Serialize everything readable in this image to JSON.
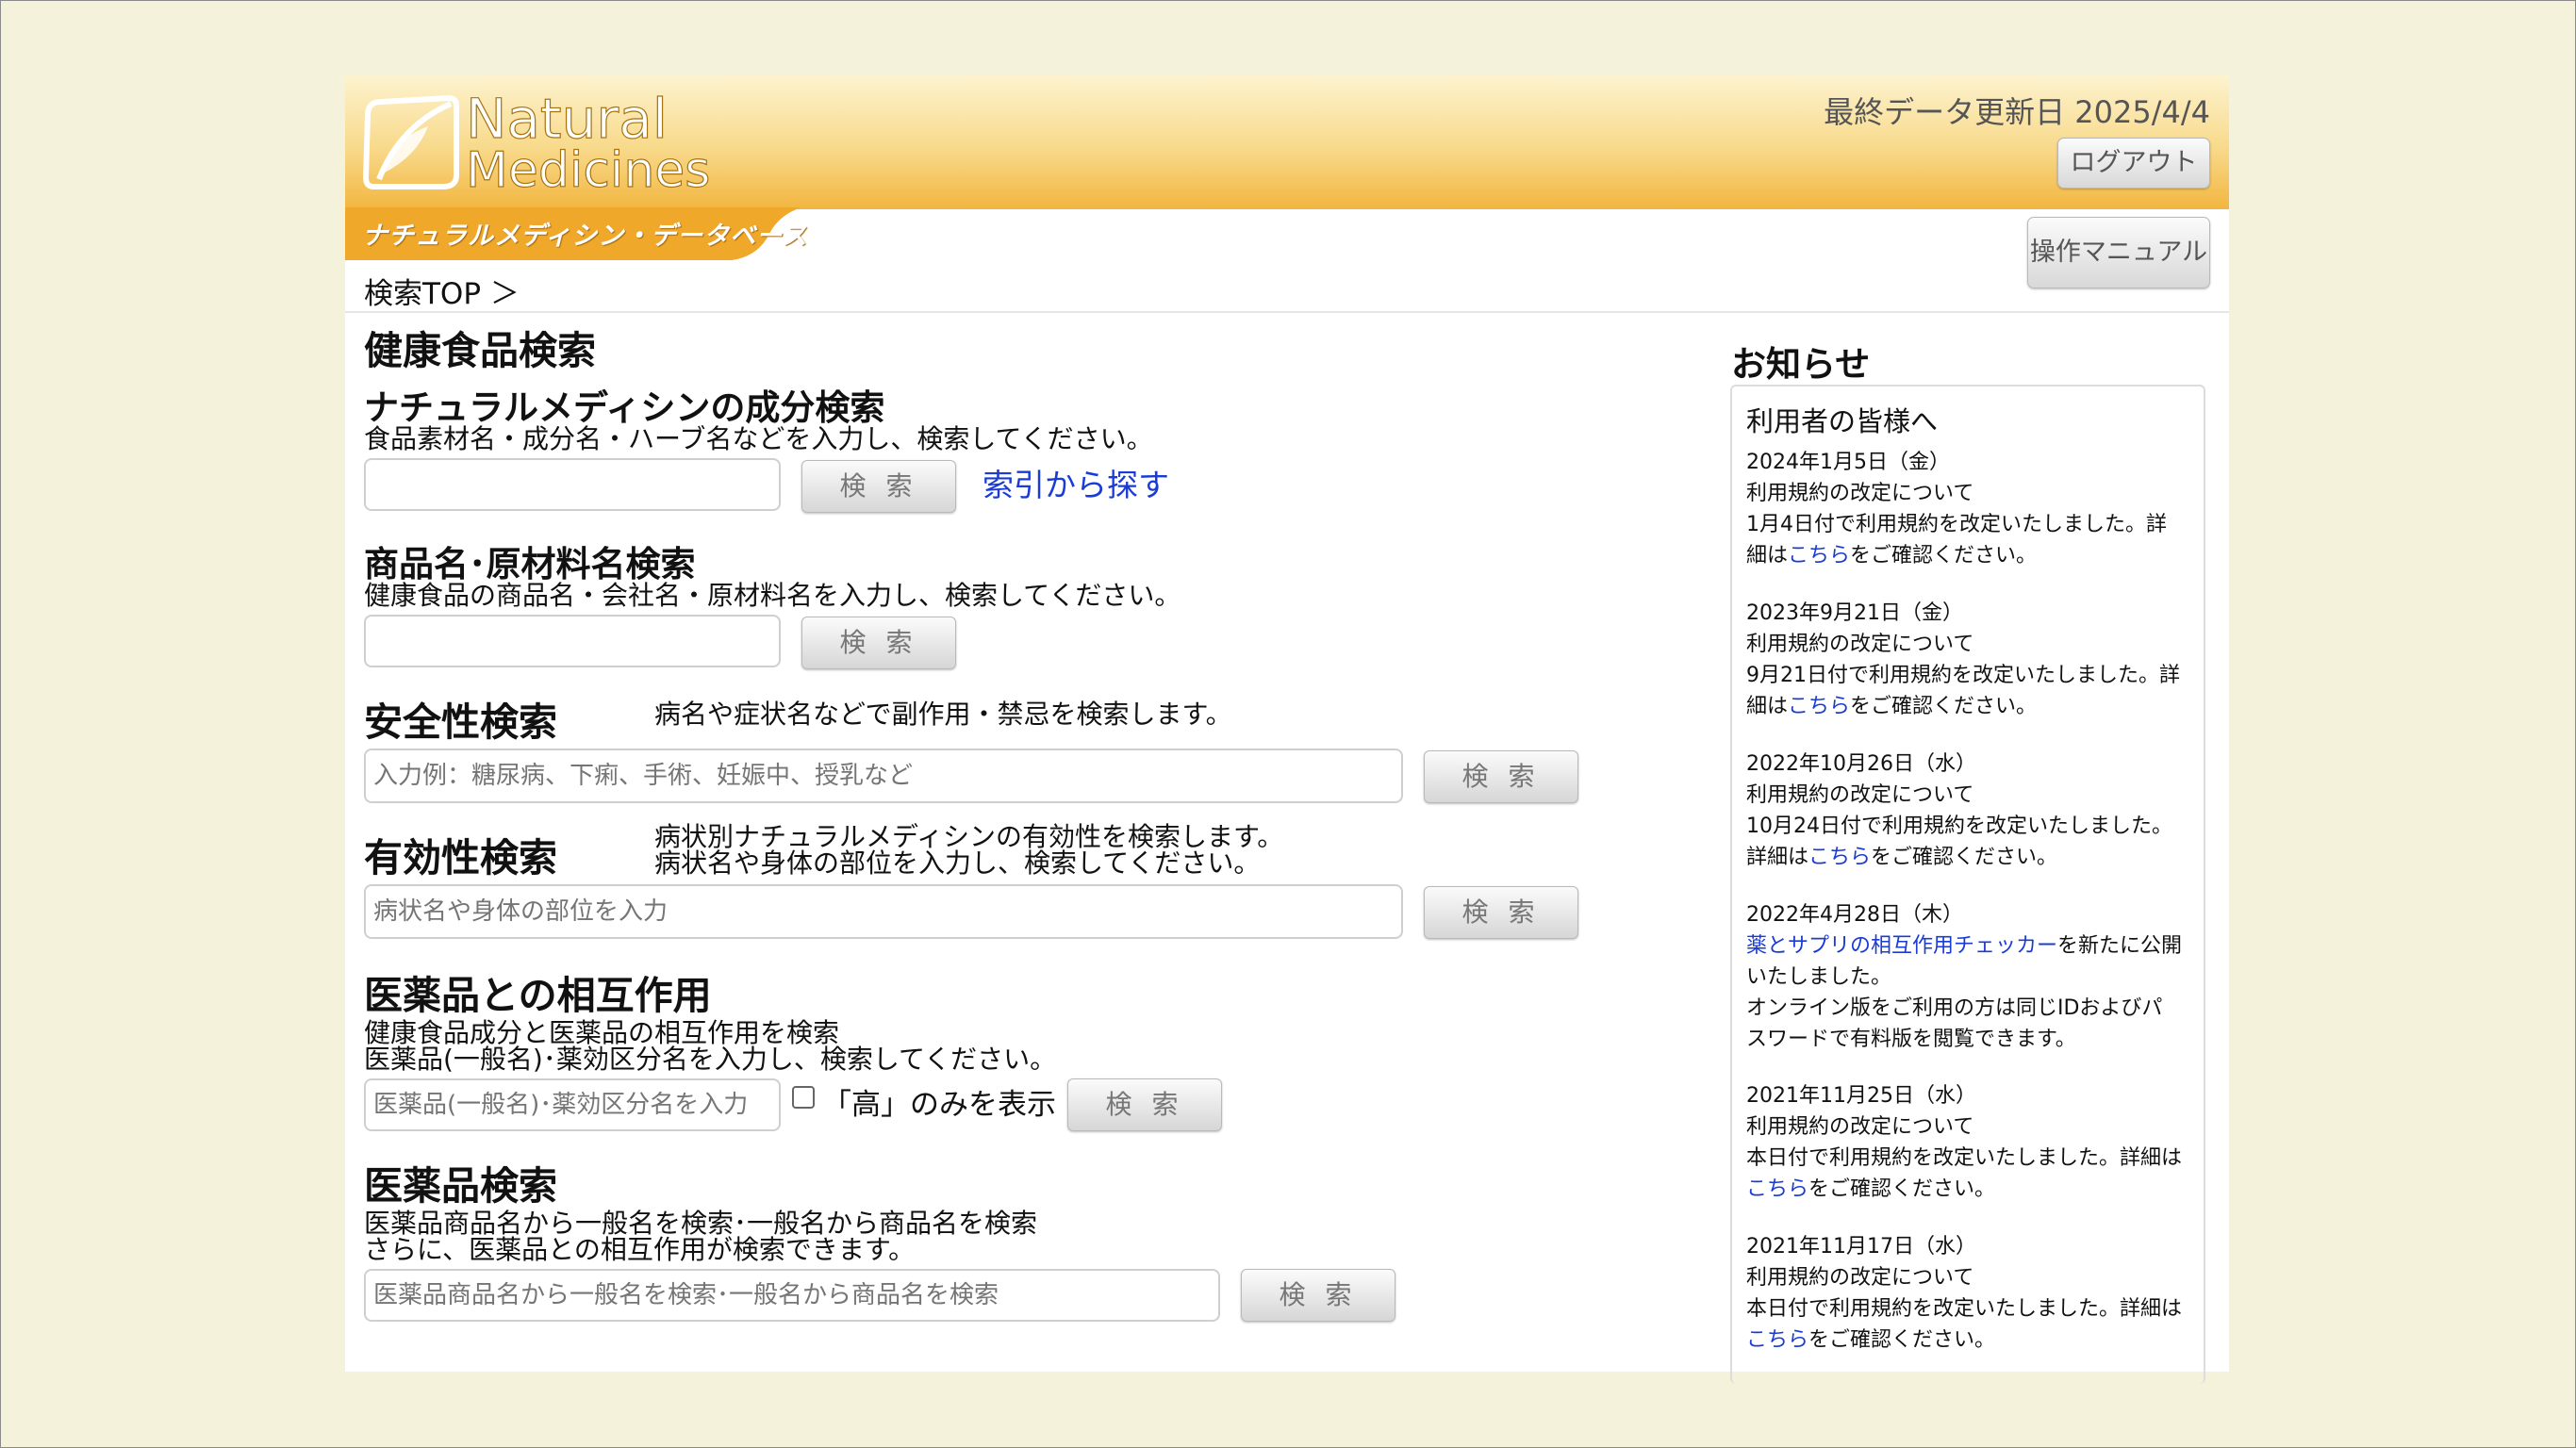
{
  "header": {
    "logo_line1": "Natural",
    "logo_line2": "Medicines",
    "subtitle": "ナチュラルメディシン・データベース",
    "last_updated": "最終データ更新日 2025/4/4",
    "logout_label": "ログアウト",
    "manual_label": "操作マニュアル",
    "breadcrumb": "検索TOP ＞"
  },
  "main": {
    "title": "健康食品検索",
    "search_button_label": "検 索",
    "ingredient": {
      "heading": "ナチュラルメディシンの成分検索",
      "desc": "食品素材名・成分名・ハーブ名などを入力し、検索してください。",
      "index_link": "索引から探す"
    },
    "product": {
      "heading": "商品名･原材料名検索",
      "desc": "健康食品の商品名・会社名・原材料名を入力し、検索してください。"
    },
    "safety": {
      "heading": "安全性検索",
      "desc": "病名や症状名などで副作用・禁忌を検索します。",
      "placeholder": "入力例：糖尿病、下痢、手術、妊娠中、授乳など"
    },
    "efficacy": {
      "heading": "有効性検索",
      "desc1": "病状別ナチュラルメディシンの有効性を検索します。",
      "desc2": "病状名や身体の部位を入力し、検索してください。",
      "placeholder": "病状名や身体の部位を入力"
    },
    "interaction": {
      "heading": "医薬品との相互作用",
      "desc1": "健康食品成分と医薬品の相互作用を検索",
      "desc2": "医薬品(一般名)･薬効区分名を入力し、検索してください。",
      "placeholder": "医薬品(一般名)･薬効区分名を入力",
      "checkbox_label": "「高」のみを表示"
    },
    "drug": {
      "heading": "医薬品検索",
      "desc1": "医薬品商品名から一般名を検索･一般名から商品名を検索",
      "desc2": "さらに、医薬品との相互作用が検索できます。",
      "placeholder": "医薬品商品名から一般名を検索･一般名から商品名を検索"
    }
  },
  "news": {
    "title": "お知らせ",
    "heading": "利用者の皆様へ",
    "link_text": "こちら",
    "items": [
      {
        "date": "2024年1月5日（金）",
        "l1": "利用規約の改定について",
        "l2": "1月4日付で利用規約を改定いたしました。詳",
        "l3a": "細は",
        "l3b": "をご確認ください。"
      },
      {
        "date": "2023年9月21日（金）",
        "l1": "利用規約の改定について",
        "l2": "9月21日付で利用規約を改定いたしました。詳",
        "l3a": "細は",
        "l3b": "をご確認ください。"
      },
      {
        "date": "2022年10月26日（水）",
        "l1": "利用規約の改定について",
        "l2": "10月24日付で利用規約を改定いたしました。",
        "l3a": "詳細は",
        "l3b": "をご確認ください。"
      },
      {
        "date": "2021年11月25日（水）",
        "l1": "利用規約の改定について",
        "l2": "本日付で利用規約を改定いたしました。詳細は",
        "l3a": "",
        "l3b": "をご確認ください。"
      },
      {
        "date": "2021年11月17日（水）",
        "l1": "利用規約の改定について",
        "l2": "本日付で利用規約を改定いたしました。詳細は",
        "l3a": "",
        "l3b": "をご確認ください。"
      }
    ],
    "checker": {
      "date": "2022年4月28日（木）",
      "link": "薬とサプリの相互作用チェッカー",
      "l1": "を新たに公開",
      "l2": "いたしました。",
      "l3": "オンライン版をご利用の方は同じIDおよびパ",
      "l4": "スワードで有料版を閲覧できます。"
    }
  },
  "colors": {
    "header_top": "#fdf3cf",
    "header_bottom": "#f2b640",
    "page_bg": "#f5f2dc",
    "link": "#1a3bd6"
  }
}
